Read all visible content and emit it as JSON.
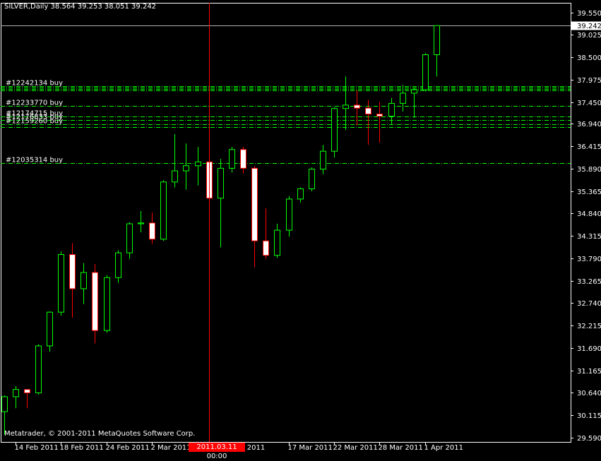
{
  "header": {
    "symbol": "SILVER,Daily",
    "ohlc": "38.564 39.253 38.051 39.242"
  },
  "footer": {
    "copyright": "Metatrader, © 2001-2011 MetaQuotes Software Corp."
  },
  "colors": {
    "background": "#000000",
    "axis": "#ffffff",
    "bull": "#00ff00",
    "bear": "#ff0000",
    "bear_body": "#ffffff",
    "order_line": "#00ff00",
    "crosshair": "#ff0000",
    "bid_line": "#b0b0b0"
  },
  "crosshair": {
    "date_label": "2011.03.11 00:00"
  },
  "chart_data": {
    "type": "candlestick",
    "title": "",
    "xlabel": "",
    "ylabel": "",
    "ylim": [
      29.59,
      39.61
    ],
    "grid": false,
    "y_ticks": [
      "39.550",
      "39.025",
      "38.500",
      "37.975",
      "37.450",
      "36.940",
      "36.415",
      "35.890",
      "35.365",
      "34.840",
      "34.315",
      "33.790",
      "33.265",
      "32.740",
      "32.215",
      "31.690",
      "31.165",
      "30.640",
      "30.115",
      "29.590"
    ],
    "x_ticks": [
      {
        "index": 1,
        "label": "14 Feb 2011"
      },
      {
        "index": 5,
        "label": "18 Feb 2011"
      },
      {
        "index": 9,
        "label": "24 Feb 2011"
      },
      {
        "index": 13,
        "label": "2 Mar 2011"
      },
      {
        "index": 17,
        "label": "8"
      },
      {
        "index": 21,
        "label": "r 2011"
      },
      {
        "index": 25,
        "label": "17 Mar 2011"
      },
      {
        "index": 29,
        "label": "22 Mar 2011"
      },
      {
        "index": 33,
        "label": "28 Mar 2011"
      },
      {
        "index": 37,
        "label": "1 Apr 2011"
      }
    ],
    "current_price": {
      "value": 39.242,
      "label": "39.242"
    },
    "order_lines": [
      {
        "price": 37.83,
        "label": "#12242134 buy"
      },
      {
        "price": 37.79,
        "label": ""
      },
      {
        "price": 37.76,
        "label": ""
      },
      {
        "price": 37.72,
        "label": ""
      },
      {
        "price": 37.36,
        "label": "#12233770 buy"
      },
      {
        "price": 37.12,
        "label": "#12174715 buy"
      },
      {
        "price": 37.03,
        "label": "#12176833 buy"
      },
      {
        "price": 36.93,
        "label": "#12159260 buy"
      },
      {
        "price": 36.86,
        "label": ""
      },
      {
        "price": 36.02,
        "label": "#12035314 buy"
      }
    ],
    "crosshair_index": 18,
    "candles": [
      {
        "o": 30.2,
        "h": 30.58,
        "l": 29.66,
        "c": 30.55
      },
      {
        "o": 30.55,
        "h": 30.8,
        "l": 30.28,
        "c": 30.72
      },
      {
        "o": 30.72,
        "h": 30.72,
        "l": 30.28,
        "c": 30.64
      },
      {
        "o": 30.64,
        "h": 31.78,
        "l": 30.6,
        "c": 31.74
      },
      {
        "o": 31.74,
        "h": 32.55,
        "l": 31.6,
        "c": 32.53
      },
      {
        "o": 32.53,
        "h": 33.95,
        "l": 32.45,
        "c": 33.88
      },
      {
        "o": 33.88,
        "h": 34.15,
        "l": 32.4,
        "c": 33.08
      },
      {
        "o": 33.08,
        "h": 33.68,
        "l": 32.72,
        "c": 33.46
      },
      {
        "o": 33.46,
        "h": 33.66,
        "l": 31.8,
        "c": 32.1
      },
      {
        "o": 32.1,
        "h": 33.4,
        "l": 32.05,
        "c": 33.34
      },
      {
        "o": 33.34,
        "h": 33.98,
        "l": 33.22,
        "c": 33.92
      },
      {
        "o": 33.92,
        "h": 34.64,
        "l": 33.78,
        "c": 34.6
      },
      {
        "o": 34.6,
        "h": 34.9,
        "l": 34.4,
        "c": 34.62
      },
      {
        "o": 34.62,
        "h": 34.86,
        "l": 34.13,
        "c": 34.24
      },
      {
        "o": 34.24,
        "h": 35.62,
        "l": 34.2,
        "c": 35.58
      },
      {
        "o": 35.58,
        "h": 36.7,
        "l": 35.45,
        "c": 35.84
      },
      {
        "o": 35.84,
        "h": 36.48,
        "l": 35.4,
        "c": 35.96
      },
      {
        "o": 35.96,
        "h": 36.4,
        "l": 35.5,
        "c": 36.05
      },
      {
        "o": 36.05,
        "h": 36.1,
        "l": 34.7,
        "c": 35.2
      },
      {
        "o": 35.2,
        "h": 36.12,
        "l": 34.05,
        "c": 35.9
      },
      {
        "o": 35.9,
        "h": 36.4,
        "l": 35.8,
        "c": 36.34
      },
      {
        "o": 36.34,
        "h": 36.4,
        "l": 35.78,
        "c": 35.9
      },
      {
        "o": 35.9,
        "h": 35.95,
        "l": 33.58,
        "c": 34.2
      },
      {
        "o": 34.2,
        "h": 34.96,
        "l": 33.78,
        "c": 33.86
      },
      {
        "o": 33.86,
        "h": 34.6,
        "l": 33.8,
        "c": 34.45
      },
      {
        "o": 34.45,
        "h": 35.25,
        "l": 34.3,
        "c": 35.18
      },
      {
        "o": 35.18,
        "h": 35.45,
        "l": 35.1,
        "c": 35.42
      },
      {
        "o": 35.42,
        "h": 35.92,
        "l": 35.36,
        "c": 35.88
      },
      {
        "o": 35.88,
        "h": 36.45,
        "l": 35.76,
        "c": 36.3
      },
      {
        "o": 36.3,
        "h": 37.33,
        "l": 36.15,
        "c": 37.3
      },
      {
        "o": 37.3,
        "h": 38.05,
        "l": 36.8,
        "c": 37.38
      },
      {
        "o": 37.38,
        "h": 37.73,
        "l": 36.9,
        "c": 37.31
      },
      {
        "o": 37.31,
        "h": 37.5,
        "l": 36.45,
        "c": 37.17
      },
      {
        "o": 37.17,
        "h": 37.45,
        "l": 36.5,
        "c": 37.12
      },
      {
        "o": 37.12,
        "h": 37.55,
        "l": 36.93,
        "c": 37.42
      },
      {
        "o": 37.42,
        "h": 37.85,
        "l": 37.23,
        "c": 37.66
      },
      {
        "o": 37.66,
        "h": 37.77,
        "l": 37.08,
        "c": 37.74
      },
      {
        "o": 37.74,
        "h": 38.6,
        "l": 37.7,
        "c": 38.56
      },
      {
        "o": 38.56,
        "h": 39.25,
        "l": 38.05,
        "c": 39.24
      }
    ]
  }
}
